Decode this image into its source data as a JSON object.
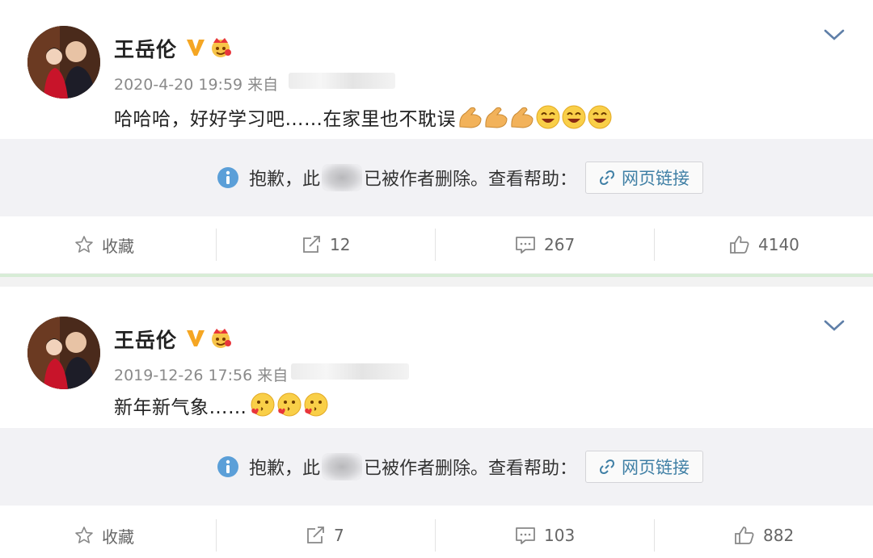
{
  "posts": [
    {
      "author": "王岳伦",
      "timestamp": "2020-4-20 19:59 来自",
      "text": "哈哈哈，好好学习吧……在家里也不耽误",
      "emojis": [
        "strong-arm-emoji",
        "strong-arm-emoji",
        "strong-arm-emoji",
        "laughing-face-emoji",
        "laughing-face-emoji",
        "laughing-face-emoji"
      ],
      "deleted_notice": {
        "prefix": "抱歉，此",
        "suffix": "已被作者删除。查看帮助：",
        "link_label": "网页链接"
      },
      "actions": {
        "favorite": "收藏",
        "repost": "12",
        "comment": "267",
        "like": "4140"
      }
    },
    {
      "author": "王岳伦",
      "timestamp": "2019-12-26 17:56 来自",
      "text": "新年新气象……",
      "emojis": [
        "kissing-heart-face-emoji",
        "kissing-heart-face-emoji",
        "kissing-heart-face-emoji"
      ],
      "deleted_notice": {
        "prefix": "抱歉，此",
        "suffix": "已被作者删除。查看帮助：",
        "link_label": "网页链接"
      },
      "actions": {
        "favorite": "收藏",
        "repost": "7",
        "comment": "103",
        "like": "882"
      }
    }
  ],
  "colors": {
    "link": "#3f7fa5",
    "verified": "#f5a623",
    "separator_accent": "#d7ecd6",
    "deleted_bg": "#f2f2f5"
  }
}
